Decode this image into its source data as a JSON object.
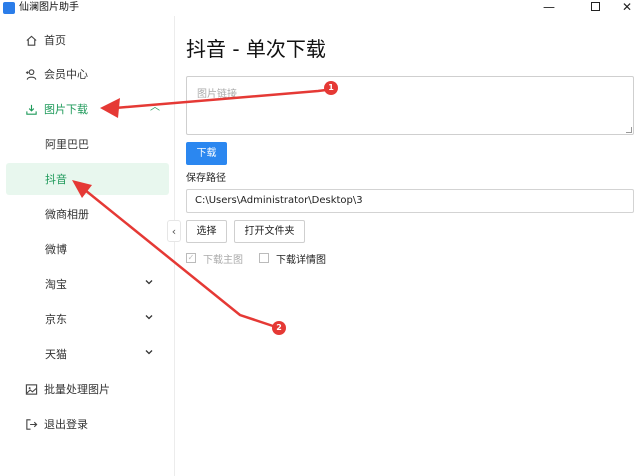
{
  "window": {
    "title": "仙澜图片助手",
    "buttons": {
      "minimize": "—",
      "close": "✕"
    }
  },
  "sidebar": {
    "items": [
      {
        "label": "首页",
        "icon": "home-icon"
      },
      {
        "label": "会员中心",
        "icon": "user-add-icon"
      },
      {
        "label": "图片下载",
        "icon": "download-icon",
        "active": true
      },
      {
        "label": "批量处理图片",
        "icon": "image-icon"
      },
      {
        "label": "退出登录",
        "icon": "logout-icon"
      }
    ],
    "sub_items": [
      {
        "label": "阿里巴巴"
      },
      {
        "label": "抖音",
        "selected": true
      },
      {
        "label": "微商相册"
      },
      {
        "label": "微博"
      },
      {
        "label": "淘宝",
        "has_children": true
      },
      {
        "label": "京东",
        "has_children": true
      },
      {
        "label": "天猫",
        "has_children": true
      }
    ],
    "collapse_glyph": "‹",
    "chevron_glyph": "⌄"
  },
  "main": {
    "title": "抖音 - 单次下载",
    "url_placeholder": "图片链接",
    "download_label": "下载",
    "save_path_label": "保存路径",
    "save_path_value": "C:\\Users\\Administrator\\Desktop\\3",
    "choose_label": "选择",
    "open_folder_label": "打开文件夹",
    "check_main_image": {
      "label": "下载主图",
      "checked": true,
      "disabled": true
    },
    "check_detail_image": {
      "label": "下载详情图",
      "checked": false
    }
  },
  "annotations": {
    "badge1": "1",
    "badge2": "2"
  },
  "colors": {
    "accent_green": "#1e9a5a",
    "selected_bg": "#e8f7ee",
    "primary_blue": "#2b87f0",
    "annotation_red": "#e53935"
  }
}
